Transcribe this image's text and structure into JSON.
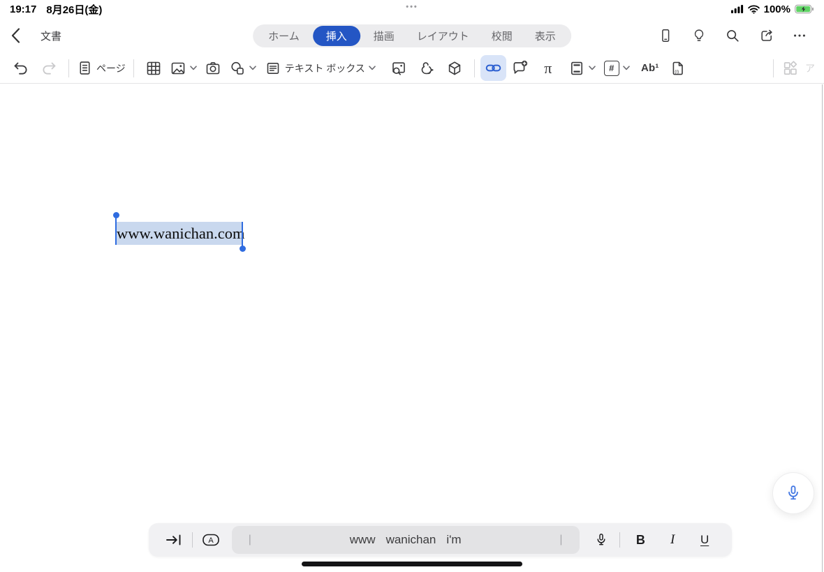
{
  "status_bar": {
    "time": "19:17",
    "date": "8月26日(金)",
    "battery_percent": "100%",
    "center_dots": "•••"
  },
  "nav": {
    "title": "文書",
    "tabs": [
      {
        "label": "ホーム",
        "active": false
      },
      {
        "label": "挿入",
        "active": true
      },
      {
        "label": "描画",
        "active": false
      },
      {
        "label": "レイアウト",
        "active": false
      },
      {
        "label": "校閲",
        "active": false
      },
      {
        "label": "表示",
        "active": false
      }
    ],
    "right_icons": [
      "mobile-view",
      "ideas-lightbulb",
      "search",
      "share",
      "more-ellipsis"
    ]
  },
  "toolbar": {
    "page_label": "ページ",
    "text_box_label": "テキスト ボックス",
    "equation_glyph": "π",
    "page_number_glyph": "#",
    "footnote_glyph": "Ab¹",
    "document_info_glyph": "(i)",
    "addins_partial_label": "ア",
    "icon_names": [
      "undo",
      "redo",
      "page",
      "table",
      "pictures",
      "camera",
      "shapes",
      "text-box",
      "online-pictures",
      "icons",
      "3d-models",
      "link",
      "new-comment",
      "equation",
      "header-footer",
      "page-number",
      "footnote",
      "document-info",
      "add-ins"
    ],
    "active_button": "link",
    "disabled_buttons": [
      "redo",
      "add-ins"
    ]
  },
  "document": {
    "selected_text": "www.wanichan.com"
  },
  "keyboard_bar": {
    "candidates": [
      "www",
      "wanichan",
      "i'm"
    ],
    "separator": "|",
    "format_buttons": {
      "bold": "B",
      "italic": "I",
      "underline": "U"
    }
  },
  "colors": {
    "accent_blue": "#2456c4",
    "link_button_bg": "#d9e4f8",
    "selection_highlight": "#c9d8ee",
    "selection_handle": "#2f6ce0",
    "mic_blue": "#4478e3",
    "battery_green": "#5fd364"
  }
}
